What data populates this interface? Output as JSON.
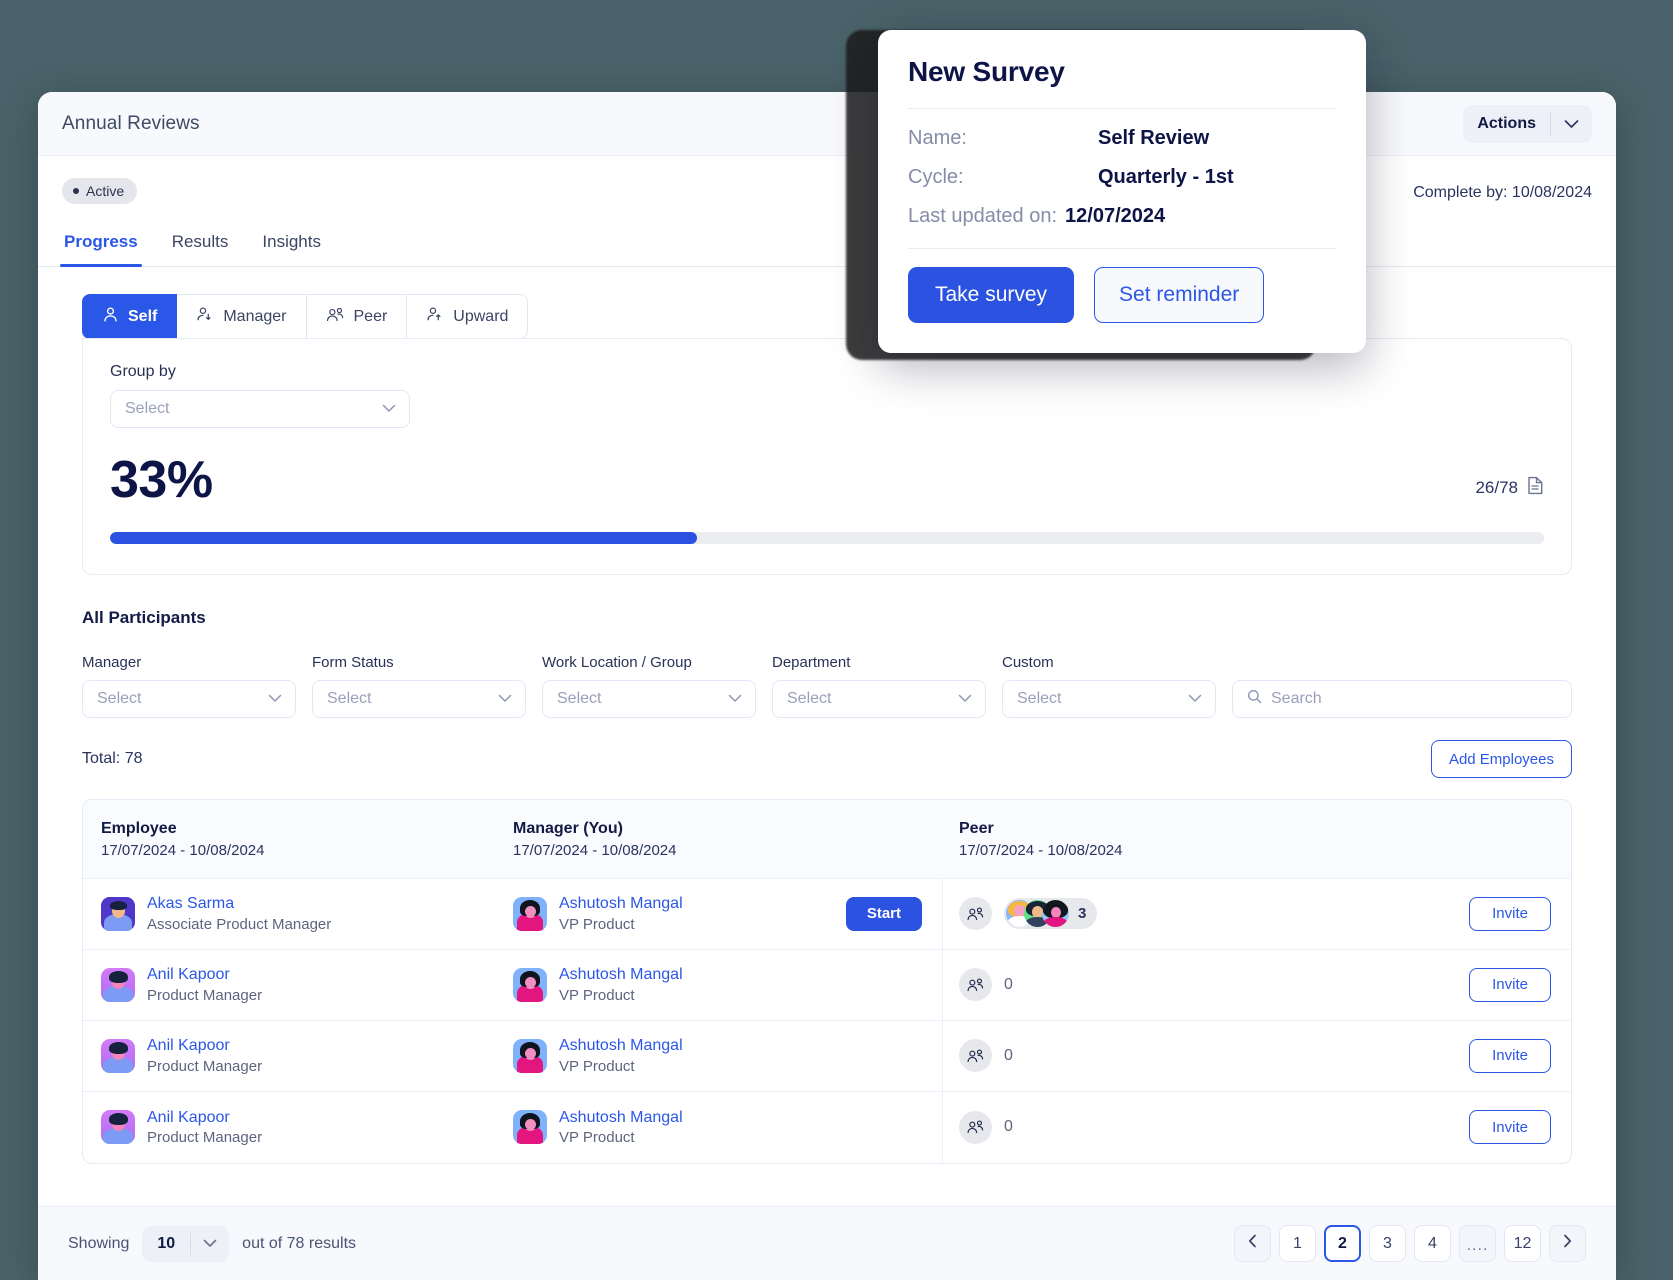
{
  "header": {
    "title": "Annual Reviews",
    "actions_label": "Actions",
    "chevron_icon": "chevron-down-icon"
  },
  "status": {
    "badge_label": "Active",
    "complete_by": "Complete by: 10/08/2024"
  },
  "main_tabs": [
    {
      "label": "Progress",
      "active": true
    },
    {
      "label": "Results",
      "active": false
    },
    {
      "label": "Insights",
      "active": false
    }
  ],
  "role_tabs": [
    {
      "label": "Self",
      "icon": "person-icon",
      "active": true
    },
    {
      "label": "Manager",
      "icon": "person-down-arrow-icon",
      "active": false
    },
    {
      "label": "Peer",
      "icon": "two-people-icon",
      "active": false
    },
    {
      "label": "Upward",
      "icon": "person-up-arrow-icon",
      "active": false
    }
  ],
  "progress": {
    "group_by_label": "Group by",
    "group_by_value": "Select",
    "percent_label": "33%",
    "percent_value": 33,
    "count_label": "26/78",
    "doc_icon": "document-icon"
  },
  "participants": {
    "section_title": "All Participants",
    "filters": [
      {
        "label": "Manager",
        "value": "Select"
      },
      {
        "label": "Form Status",
        "value": "Select"
      },
      {
        "label": "Work Location / Group",
        "value": "Select"
      },
      {
        "label": "Department",
        "value": "Select"
      },
      {
        "label": "Custom",
        "value": "Select"
      }
    ],
    "search_placeholder": "Search",
    "search_icon": "search-icon",
    "total_label": "Total: 78",
    "add_employees_label": "Add Employees"
  },
  "table": {
    "columns": [
      {
        "title": "Employee",
        "dates": "17/07/2024 - 10/08/2024"
      },
      {
        "title": "Manager (You)",
        "dates": "17/07/2024 - 10/08/2024"
      },
      {
        "title": "Peer",
        "dates": "17/07/2024 - 10/08/2024"
      }
    ],
    "rows": [
      {
        "employee": {
          "name": "Akas Sarma",
          "role": "Associate Product Manager",
          "avatar": "avatar-akas"
        },
        "manager": {
          "name": "Ashutosh Mangal",
          "role": "VP Product",
          "avatar": "avatar-ashutosh"
        },
        "manager_action": "Start",
        "peer_count": "3",
        "peer_has_avatars": true,
        "peer_action": "Invite"
      },
      {
        "employee": {
          "name": "Anil Kapoor",
          "role": "Product Manager",
          "avatar": "avatar-anil"
        },
        "manager": {
          "name": "Ashutosh Mangal",
          "role": "VP Product",
          "avatar": "avatar-ashutosh"
        },
        "manager_action": "",
        "peer_count": "0",
        "peer_has_avatars": false,
        "peer_action": "Invite"
      },
      {
        "employee": {
          "name": "Anil Kapoor",
          "role": "Product Manager",
          "avatar": "avatar-anil"
        },
        "manager": {
          "name": "Ashutosh Mangal",
          "role": "VP Product",
          "avatar": "avatar-ashutosh"
        },
        "manager_action": "",
        "peer_count": "0",
        "peer_has_avatars": false,
        "peer_action": "Invite"
      },
      {
        "employee": {
          "name": "Anil Kapoor",
          "role": "Product Manager",
          "avatar": "avatar-anil"
        },
        "manager": {
          "name": "Ashutosh Mangal",
          "role": "VP Product",
          "avatar": "avatar-ashutosh"
        },
        "manager_action": "",
        "peer_count": "0",
        "peer_has_avatars": false,
        "peer_action": "Invite"
      }
    ]
  },
  "footer": {
    "showing_label": "Showing",
    "page_size": "10",
    "out_of_label": "out of 78 results",
    "pages": [
      "1",
      "2",
      "3",
      "4",
      "....",
      "12"
    ],
    "active_page": "2",
    "prev_icon": "chevron-left-icon",
    "next_icon": "chevron-right-icon"
  },
  "modal": {
    "title": "New Survey",
    "name_key": "Name:",
    "name_value": "Self Review",
    "cycle_key": "Cycle:",
    "cycle_value": "Quarterly - 1st",
    "updated_key": "Last updated on:",
    "updated_value": "12/07/2024",
    "primary_label": "Take survey",
    "secondary_label": "Set reminder"
  },
  "colors": {
    "accent": "#2b52e0",
    "link": "#2b57e8",
    "dark_text": "#0d1446",
    "page_bg": "#4a6269"
  }
}
